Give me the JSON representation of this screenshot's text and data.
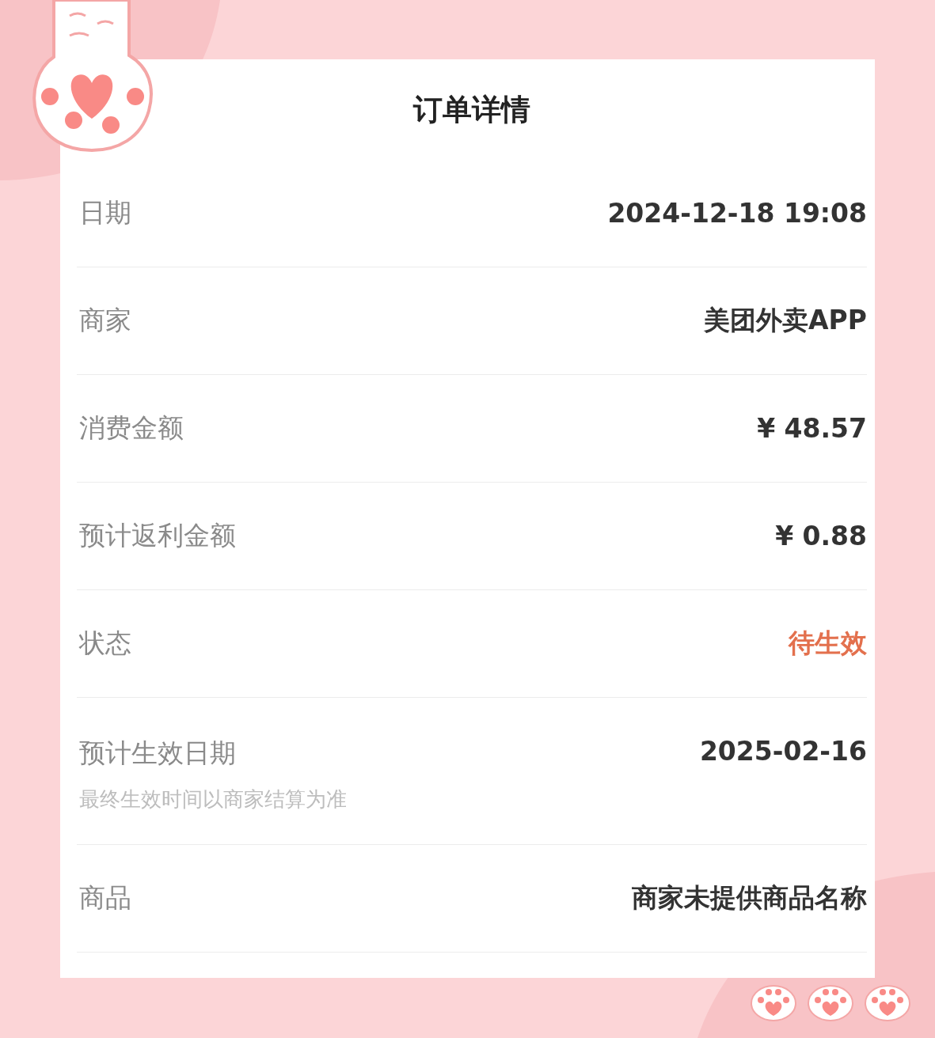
{
  "title": "订单详情",
  "rows": [
    {
      "label": "日期",
      "value": "2024-12-18 19:08",
      "kind": "plain"
    },
    {
      "label": "商家",
      "value": "美团外卖APP",
      "kind": "plain"
    },
    {
      "label": "消费金额",
      "value": "¥ 48.57",
      "kind": "plain"
    },
    {
      "label": "预计返利金额",
      "value": "¥ 0.88",
      "kind": "plain"
    },
    {
      "label": "状态",
      "value": "待生效",
      "kind": "status"
    },
    {
      "label": "预计生效日期",
      "value": "2025-02-16",
      "kind": "plain",
      "note": "最终生效时间以商家结算为准"
    },
    {
      "label": "商品",
      "value": "商家未提供商品名称",
      "kind": "plain"
    }
  ]
}
